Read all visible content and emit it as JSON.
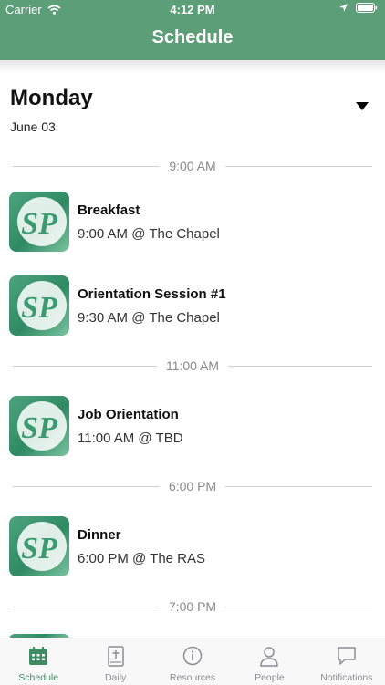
{
  "status_bar": {
    "carrier": "Carrier",
    "time": "4:12 PM"
  },
  "header": {
    "title": "Schedule"
  },
  "day": {
    "name": "Monday",
    "date": "June 03"
  },
  "logo_text": "SP",
  "separators": [
    "9:00 AM",
    "11:00 AM",
    "6:00 PM",
    "7:00 PM"
  ],
  "events": [
    {
      "title": "Breakfast",
      "subtitle": "9:00 AM @ The Chapel"
    },
    {
      "title": "Orientation Session #1",
      "subtitle": "9:30 AM @ The Chapel"
    },
    {
      "title": "Job Orientation",
      "subtitle": "11:00 AM @ TBD"
    },
    {
      "title": "Dinner",
      "subtitle": "6:00 PM @ The RAS"
    }
  ],
  "tabs": [
    {
      "label": "Schedule",
      "icon": "calendar-icon",
      "active": true
    },
    {
      "label": "Daily",
      "icon": "bible-icon",
      "active": false
    },
    {
      "label": "Resources",
      "icon": "info-icon",
      "active": false
    },
    {
      "label": "People",
      "icon": "person-icon",
      "active": false
    },
    {
      "label": "Notifications",
      "icon": "chat-bubble-icon",
      "active": false
    }
  ],
  "colors": {
    "accent": "#5c9e78",
    "active_tab": "#3f8b63",
    "inactive_tab": "#8e8e93"
  }
}
